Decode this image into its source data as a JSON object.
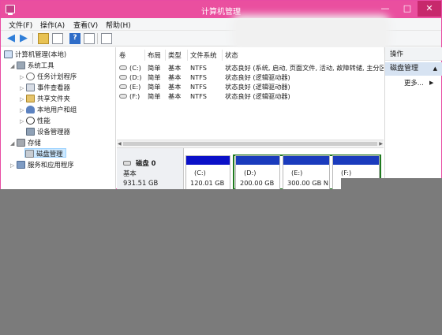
{
  "window": {
    "title": "计算机管理",
    "controls": {
      "minimize": "—",
      "maximize": "□",
      "close": "✕"
    }
  },
  "menu": [
    "文件(F)",
    "操作(A)",
    "查看(V)",
    "帮助(H)"
  ],
  "toolbar": [
    "back-icon",
    "forward-icon",
    "up-folder-icon",
    "console-tree-icon",
    "help-icon",
    "details-icon",
    "export-icon"
  ],
  "tree": {
    "root": "计算机管理(本地)",
    "system_tools": "系统工具",
    "task_scheduler": "任务计划程序",
    "event_viewer": "事件查看器",
    "shared_folders": "共享文件夹",
    "local_users": "本地用户和组",
    "performance": "性能",
    "device_manager": "设备管理器",
    "storage": "存储",
    "disk_management": "磁盘管理",
    "services_apps": "服务和应用程序"
  },
  "volume_table": {
    "headers": [
      "卷",
      "布局",
      "类型",
      "文件系统",
      "状态"
    ],
    "rows": [
      {
        "vol": "(C:)",
        "layout": "简单",
        "type": "基本",
        "fs": "NTFS",
        "status": "状态良好 (系统, 启动, 页面文件, 活动, 故障转储, 主分区)"
      },
      {
        "vol": "(D:)",
        "layout": "简单",
        "type": "基本",
        "fs": "NTFS",
        "status": "状态良好 (逻辑驱动器)"
      },
      {
        "vol": "(E:)",
        "layout": "简单",
        "type": "基本",
        "fs": "NTFS",
        "status": "状态良好 (逻辑驱动器)"
      },
      {
        "vol": "(F:)",
        "layout": "简单",
        "type": "基本",
        "fs": "NTFS",
        "status": "状态良好 (逻辑驱动器)"
      }
    ]
  },
  "disk": {
    "name": "磁盘 0",
    "type": "基本",
    "size": "931.51 GB",
    "partitions": [
      {
        "label": "(C:)",
        "size": "120.01 GB",
        "kind": "primary"
      },
      {
        "label": "(D:)",
        "size": "200.00 GB",
        "kind": "logical"
      },
      {
        "label": "(E:)",
        "size": "300.00 GB N",
        "kind": "logical"
      },
      {
        "label": "(F:)",
        "size": "",
        "kind": "logical"
      }
    ]
  },
  "actions": {
    "header": "操作",
    "group": "磁盘管理",
    "more": "更多..."
  },
  "colors": {
    "titlebar": "#ea4f9f",
    "primary_partition": "#0a10c8",
    "logical_partition": "#1a3bbd",
    "extended_border": "#1f7a1f",
    "overlay_gray": "#7b7b7b"
  }
}
